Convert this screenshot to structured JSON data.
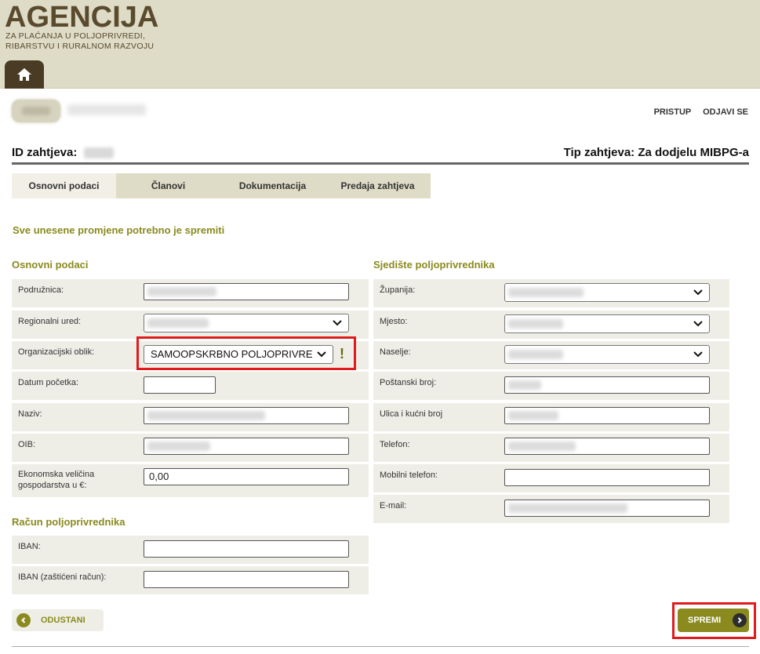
{
  "header": {
    "logo_title": "AGENCIJA",
    "logo_sub_1": "ZA PLAĆANJA U POLJOPRIVREDI,",
    "logo_sub_2": "RIBARSTVU I RURALNOM RAZVOJU",
    "home_icon": "home-icon"
  },
  "userbar": {
    "links": [
      "PRISTUP",
      "ODJAVI SE"
    ]
  },
  "request": {
    "id_label": "ID zahtjeva:",
    "type_label": "Tip zahtjeva: Za dodjelu MIBPG-a"
  },
  "tabs": [
    "Osnovni podaci",
    "Članovi",
    "Dokumentacija",
    "Predaja zahtjeva"
  ],
  "notice": "Sve unesene promjene potrebno je spremiti",
  "basic": {
    "title": "Osnovni podaci",
    "fields": {
      "podruznica": "Podružnica:",
      "regionalni_ured": "Regionalni ured:",
      "org_oblik": "Organizacijski oblik:",
      "org_oblik_value": "SAMOOPSKRBNO POLJOPRIVREDNO GOSPODARSTVO",
      "warn": "!",
      "datum_pocetka": "Datum početka:",
      "naziv": "Naziv:",
      "oib": "OIB:",
      "eko_1": "Ekonomska veličina",
      "eko_2": "gospodarstva u €:",
      "eko_value": "0,00"
    }
  },
  "account": {
    "title": "Račun poljoprivrednika",
    "iban": "IBAN:",
    "iban_protected": "IBAN (zaštićeni račun):"
  },
  "seat": {
    "title": "Sjedište poljoprivrednika",
    "zupanija": "Županija:",
    "mjesto": "Mjesto:",
    "naselje": "Naselje:",
    "postanski_broj": "Poštanski broj:",
    "ulica": "Ulica i kućni broj",
    "telefon": "Telefon:",
    "mobilni": "Mobilni telefon:",
    "email": "E-mail:"
  },
  "buttons": {
    "cancel": "ODUSTANI",
    "save": "SPREMI"
  },
  "colors": {
    "accent": "#8a8a1e",
    "header_bg": "#dedbc6",
    "highlight": "#e11b1b"
  }
}
